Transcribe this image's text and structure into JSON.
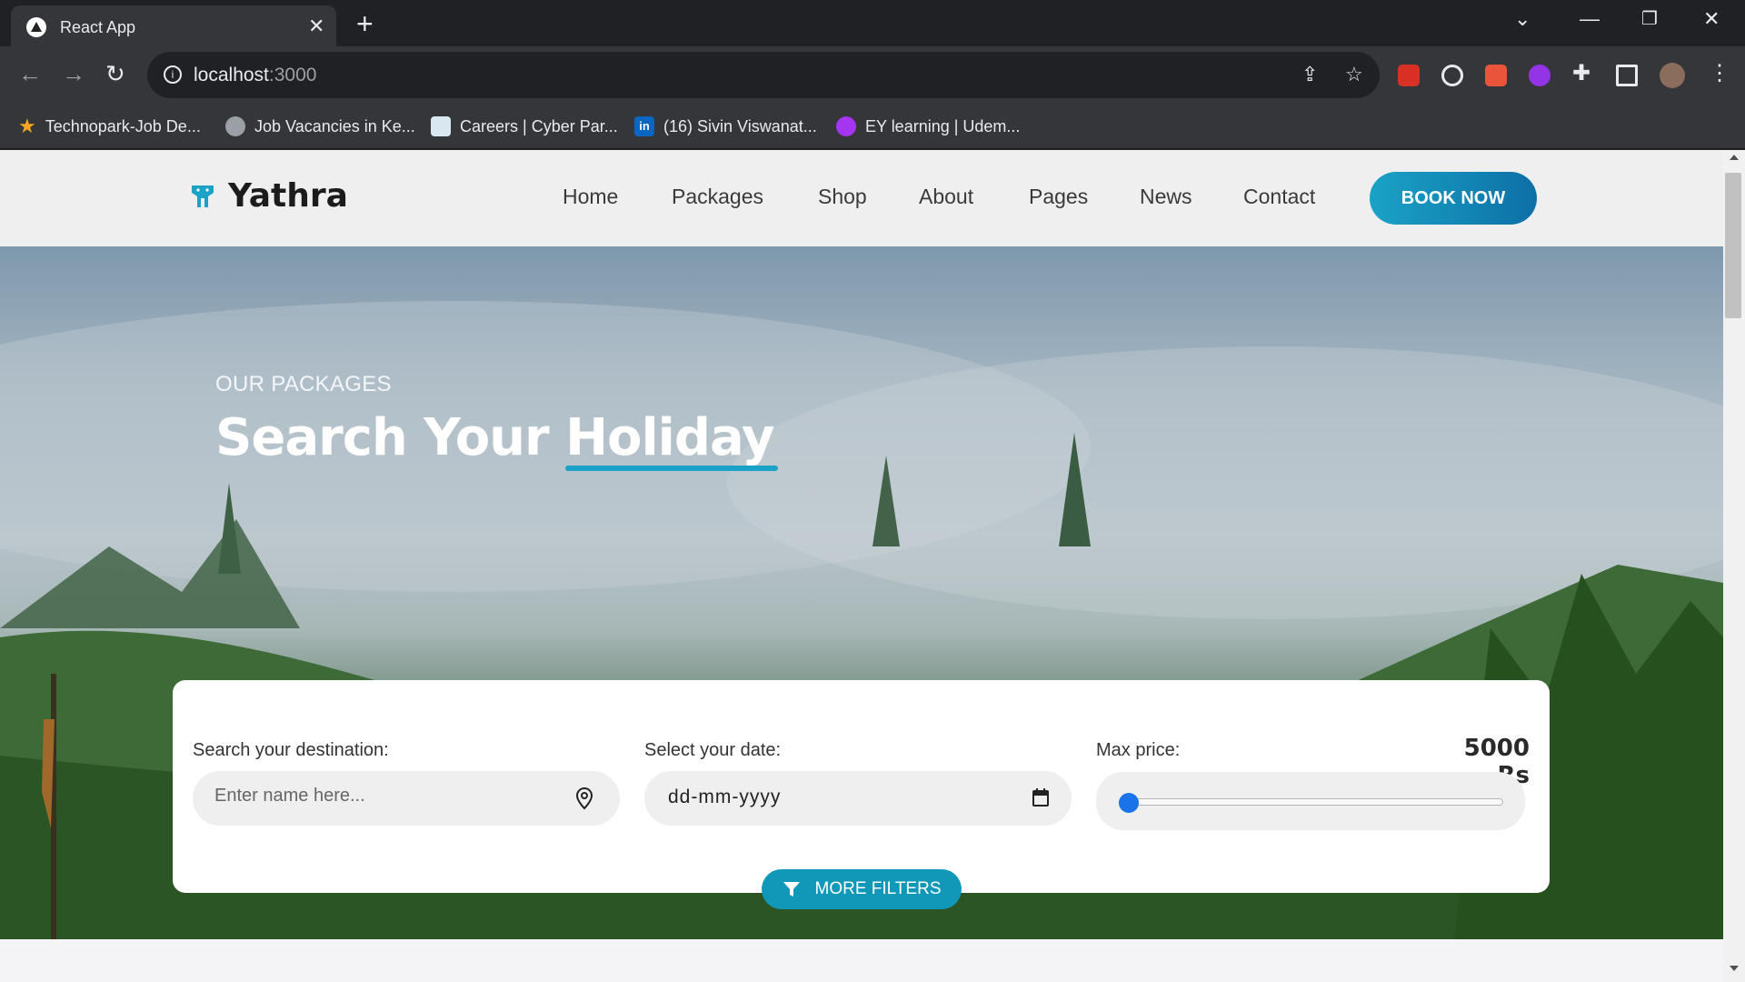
{
  "browser": {
    "tab_title": "React App",
    "url_host": "localhost",
    "url_port": ":3000",
    "bookmarks": [
      {
        "label": "Technopark-Job De..."
      },
      {
        "label": "Job Vacancies in Ke..."
      },
      {
        "label": "Careers | Cyber Par..."
      },
      {
        "label": "(16) Sivin Viswanat..."
      },
      {
        "label": "EY learning | Udem..."
      }
    ]
  },
  "site": {
    "logo_text": "Yathra",
    "nav": [
      "Home",
      "Packages",
      "Shop",
      "About",
      "Pages",
      "News",
      "Contact"
    ],
    "cta_label": "BOOK NOW"
  },
  "hero": {
    "subtitle": "OUR PACKAGES",
    "title_part1": "Search Your ",
    "title_highlight": "Holiday"
  },
  "search": {
    "destination_label": "Search your destination:",
    "destination_placeholder": "Enter name here...",
    "date_label": "Select your date:",
    "date_value": "dd-mm-yyyy",
    "price_label": "Max price:",
    "price_value": "5000 Rs",
    "price_slider_fraction": 0,
    "more_filters_label": "MORE FILTERS"
  },
  "colors": {
    "accent": "#1aa3c6",
    "accent_dark": "#0d6fa6",
    "slider_thumb": "#1a73e8"
  }
}
